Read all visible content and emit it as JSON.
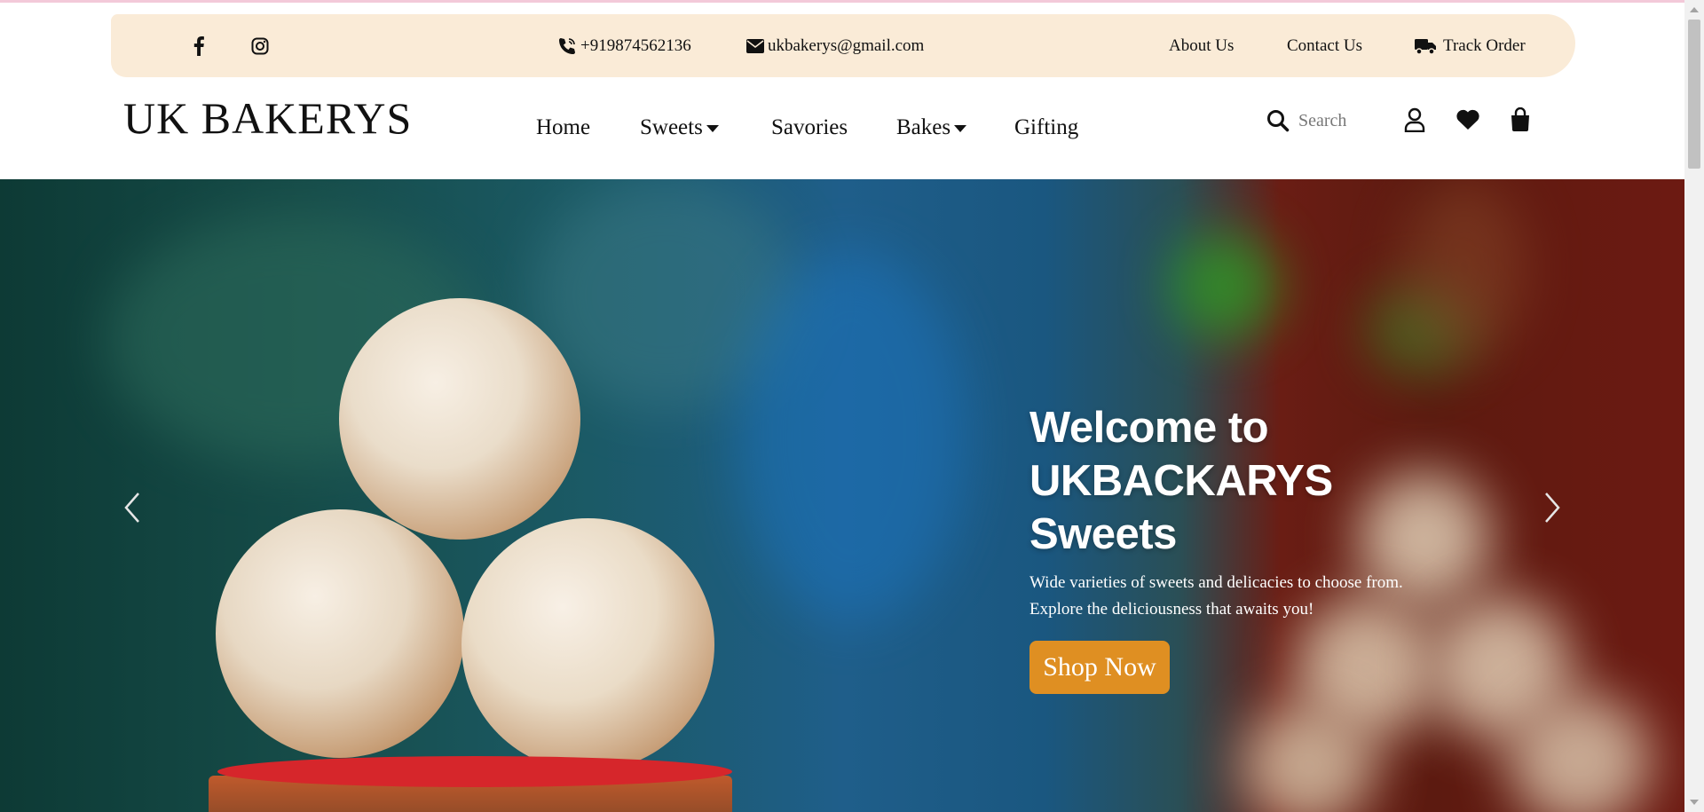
{
  "topbar": {
    "social": [
      {
        "icon": "facebook-icon"
      },
      {
        "icon": "instagram-icon"
      }
    ],
    "phone": "+919874562136",
    "email": "ukbakerys@gmail.com",
    "links": {
      "about": "About Us",
      "contact": "Contact Us",
      "track": "Track Order"
    },
    "bg_color": "#faebd7"
  },
  "header": {
    "logo": "UK BAKERYS",
    "nav": {
      "home": "Home",
      "sweets": "Sweets",
      "savories": "Savories",
      "bakes": "Bakes",
      "gifting": "Gifting"
    },
    "search": {
      "placeholder": "Search",
      "value": ""
    },
    "icons": [
      "search-icon",
      "user-icon",
      "heart-icon",
      "bag-icon"
    ]
  },
  "hero": {
    "title_line1": "Welcome to",
    "title_line2": "UKBACKARYS",
    "title_line3": "Sweets",
    "subtitle_line1": "Wide varieties of sweets and delicacies to choose from.",
    "subtitle_line2": "Explore the deliciousness that awaits you!",
    "cta": "Shop Now",
    "cta_color": "#df8f22",
    "arrows": [
      "chevron-left-icon",
      "chevron-right-icon"
    ]
  }
}
